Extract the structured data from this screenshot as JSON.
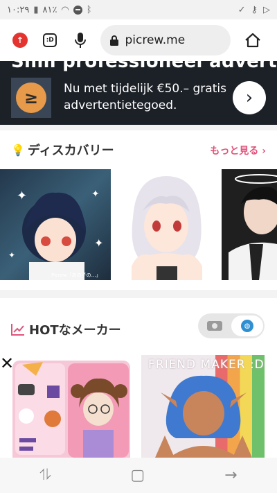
{
  "status_bar": {
    "time": "١٠:٢٩",
    "battery": "٨١٪",
    "icons": [
      "battery-icon",
      "wifi-icon",
      "do-not-disturb-icon",
      "bluetooth-icon",
      "check-circle-icon",
      "key-icon",
      "play-icon"
    ]
  },
  "toolbar": {
    "url": "picrew.me",
    "emoji_label": ":D"
  },
  "ad": {
    "headline_partial": "Slim professioneel adverteren",
    "text": "Nu met tijdelijk €50.– gratis advertentietegoed.",
    "logo_glyph": "≥",
    "arrow_glyph": "›"
  },
  "discovery": {
    "title": "ディスカバリー",
    "more_label": "もっと見る",
    "more_chevron": "›",
    "credit": "Picrew「あの子の…」"
  },
  "hot": {
    "title": "HOTなメーカー",
    "card2_title": "FRIEND MAKER :D",
    "close_glyph": "✕"
  },
  "navbar": {
    "recent_glyph": "⥮",
    "home_glyph": "▢",
    "back_glyph": "→"
  }
}
